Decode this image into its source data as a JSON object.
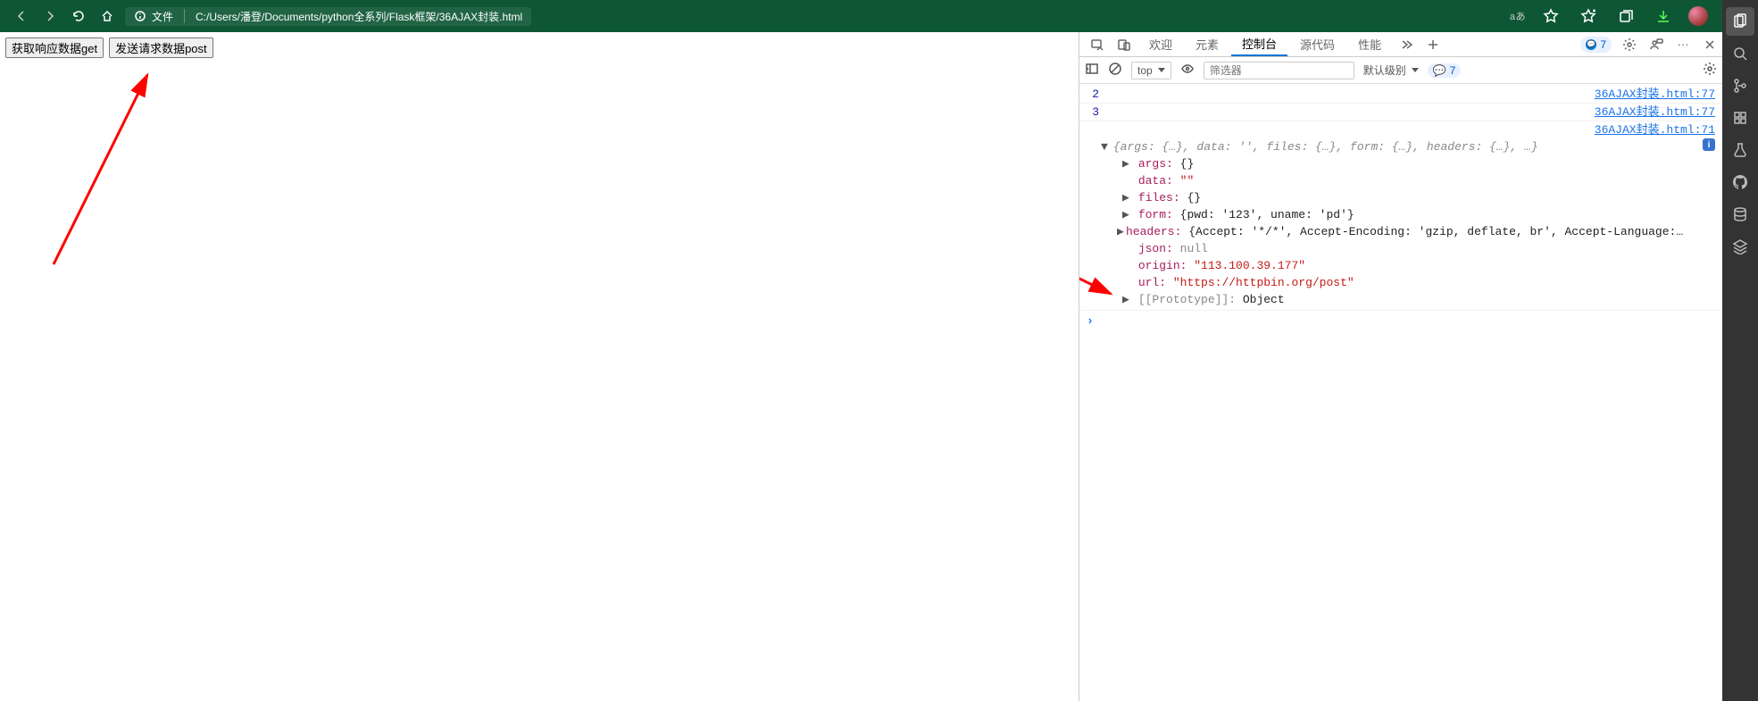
{
  "browser": {
    "url_chip_label": "文件",
    "url": "C:/Users/潘登/Documents/python全系列/Flask框架/36AJAX封装.html",
    "reading_mode_label": "aあ"
  },
  "page": {
    "btn_get": "获取响应数据get",
    "btn_post": "发送请求数据post"
  },
  "devtools": {
    "tabs": {
      "welcome": "欢迎",
      "elements": "元素",
      "console": "控制台",
      "sources": "源代码",
      "performance": "性能"
    },
    "issues_count": "7",
    "toolbar": {
      "exec_ctx": "top",
      "filter_placeholder": "筛选器",
      "level_label": "默认级别",
      "badge_count": "7"
    },
    "logs": [
      {
        "n": "2",
        "link": "36AJAX封装.html:77"
      },
      {
        "n": "3",
        "link": "36AJAX封装.html:77"
      }
    ],
    "obj": {
      "summary_prefix": "{args: {…}, data: '', files: {…}, form: {…}, headers: {…}, …}",
      "source_link": "36AJAX封装.html:71",
      "props": {
        "args": "{}",
        "data": "\"\"",
        "files": "{}",
        "form": "{pwd: '123', uname: 'pd'}",
        "headers": "{Accept: '*/*', Accept-Encoding: 'gzip, deflate, br', Accept-Language:…",
        "json": "null",
        "origin": "\"113.100.39.177\"",
        "url": "\"https://httpbin.org/post\"",
        "prototype": "Object"
      }
    }
  }
}
